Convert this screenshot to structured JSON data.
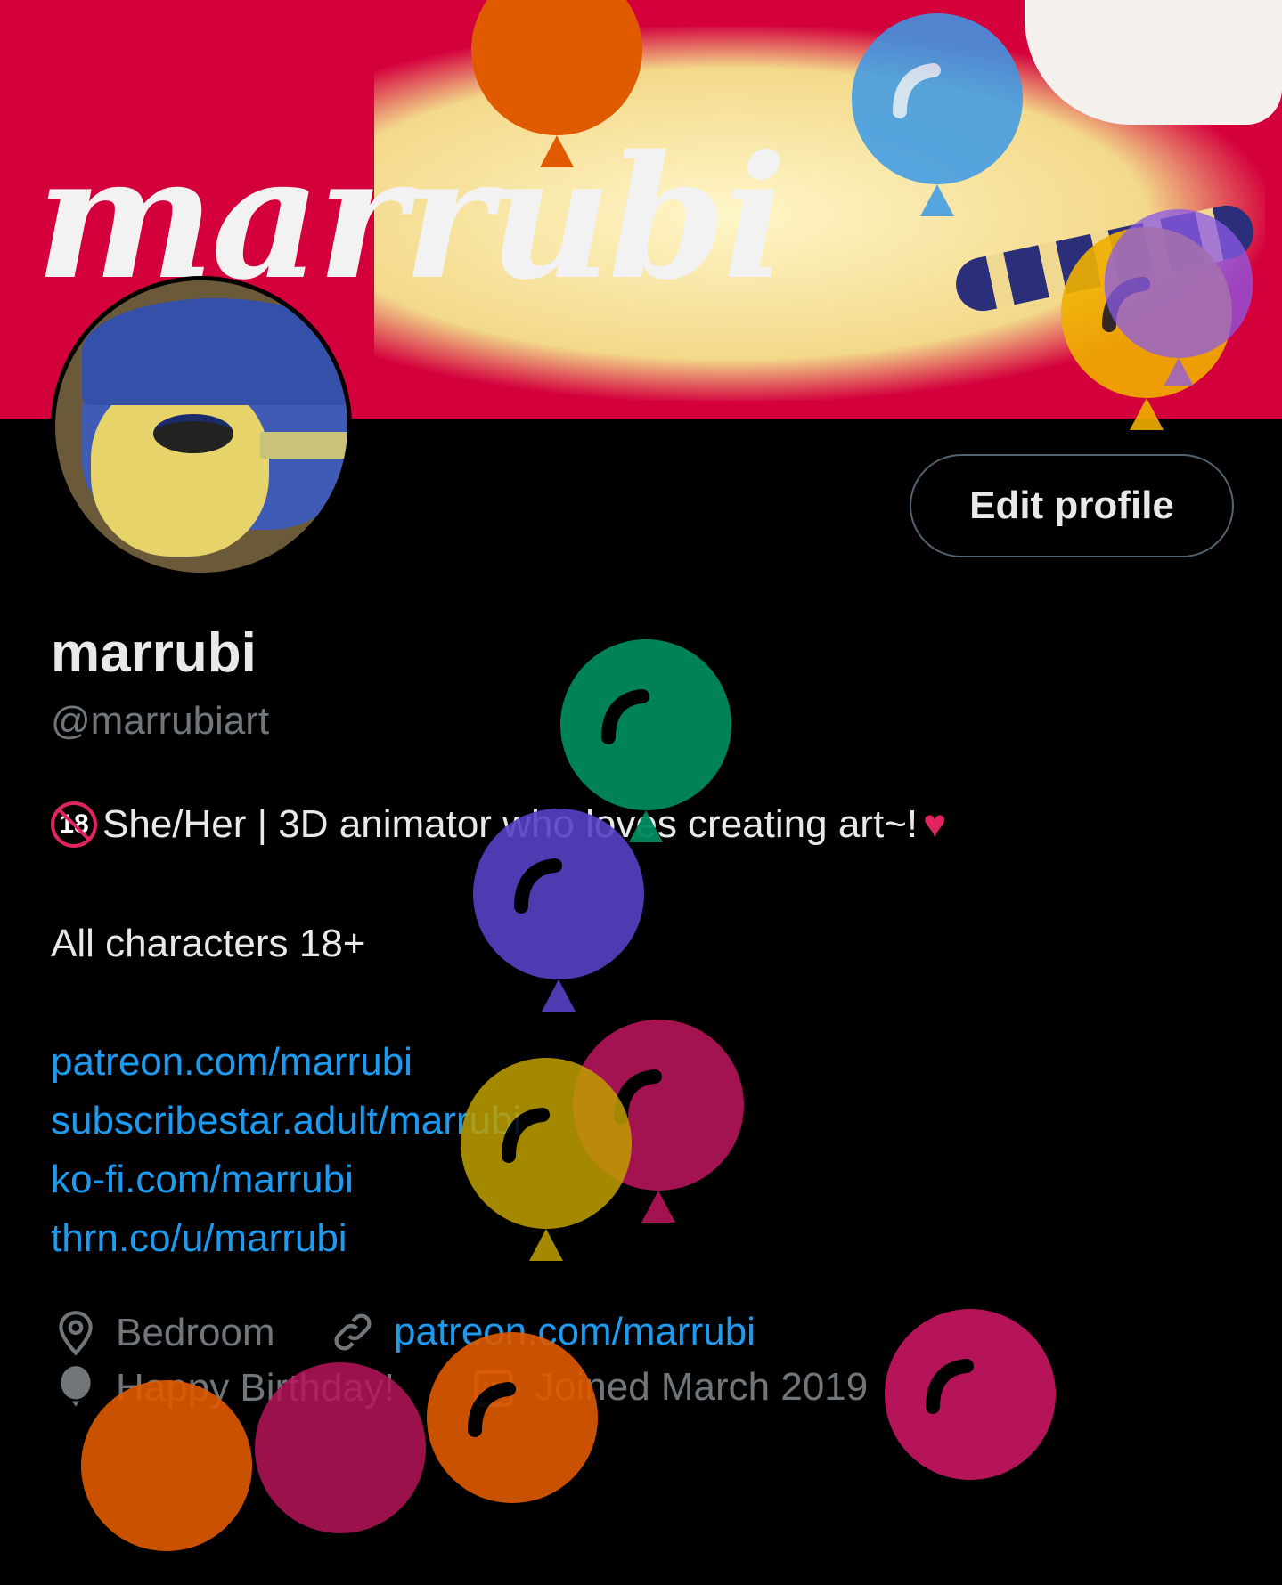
{
  "banner": {
    "title": "marrubi"
  },
  "header": {
    "edit_profile_label": "Edit profile"
  },
  "profile": {
    "display_name": "marrubi",
    "handle": "@marrubiart",
    "bio_line1": "She/Her | 3D animator who loves creating art~!",
    "bio_badge": "18",
    "bio_heart": "♥",
    "bio_line2": "All characters 18+",
    "links": [
      "patreon.com/marrubi",
      "subscribestar.adult/marrubi",
      "ko-fi.com/marrubi",
      "thrn.co/u/marrubi"
    ],
    "location": "Bedroom",
    "website": "patreon.com/marrubi",
    "birthday": "Happy Birthday!",
    "joined": "Joined March 2019"
  },
  "icons": {
    "location": "location-pin-icon",
    "link": "link-icon",
    "birthday": "balloon-icon",
    "joined": "calendar-icon"
  },
  "colors": {
    "background": "#000000",
    "banner": "#d4003c",
    "link": "#1d9bf0",
    "secondary_text": "#71767b",
    "balloons": [
      "#008a5e",
      "#5841c6",
      "#c0a000",
      "#b5145a",
      "#e05a00",
      "#3b9ae8",
      "#8c5ae8",
      "#f0b000"
    ]
  }
}
